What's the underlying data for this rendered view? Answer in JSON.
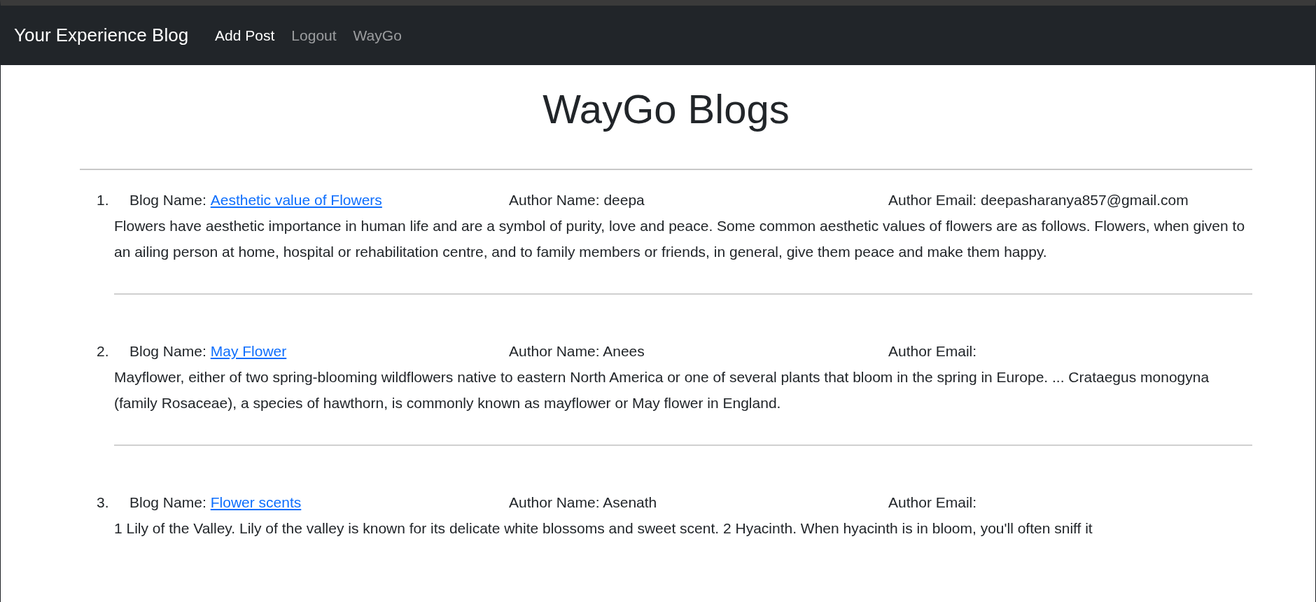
{
  "navbar": {
    "brand": "Your Experience Blog",
    "links": [
      {
        "label": "Add Post",
        "selected": true
      },
      {
        "label": "Logout",
        "selected": false
      },
      {
        "label": "WayGo",
        "selected": false
      }
    ]
  },
  "heading": "WayGo Blogs",
  "posts": [
    {
      "number": "1.",
      "blog_label": "Blog Name:",
      "blog_name": "Aesthetic value of Flowers",
      "author_name": "Author Name: deepa",
      "author_email": "Author Email: deepasharanya857@gmail.com",
      "description": "Flowers have aesthetic importance in human life and are a symbol of purity, love and peace. Some common aesthetic values of flowers are as follows. Flowers, when given to an ailing person at home, hospital or rehabilitation centre, and to family members or friends, in general, give them peace and make them happy."
    },
    {
      "number": "2.",
      "blog_label": "Blog Name:",
      "blog_name": "May Flower",
      "author_name": "Author Name: Anees",
      "author_email": "Author Email:",
      "description": "Mayflower, either of two spring-blooming wildflowers native to eastern North America or one of several plants that bloom in the spring in Europe. ... Crataegus monogyna (family Rosaceae), a species of hawthorn, is commonly known as mayflower or May flower in England."
    },
    {
      "number": "3.",
      "blog_label": "Blog Name:",
      "blog_name": "Flower scents",
      "author_name": "Author Name: Asenath",
      "author_email": "Author Email:",
      "description": "1 Lily of the Valley. Lily of the valley is known for its delicate white blossoms and sweet scent. 2 Hyacinth. When hyacinth is in bloom, you'll often sniff it"
    }
  ]
}
